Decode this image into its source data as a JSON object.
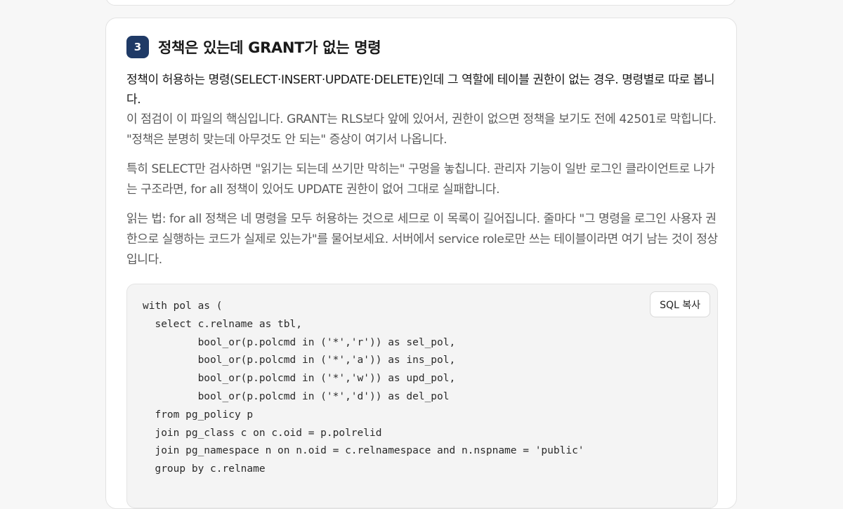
{
  "section": {
    "step_number": "3",
    "title": "정책은 있는데 GRANT가 없는 명령",
    "lead": "정책이 허용하는 명령(SELECT·INSERT·UPDATE·DELETE)인데 그 역할에 테이블 권한이 없는 경우. 명령별로 따로 봅니다.",
    "paragraphs": [
      "이 점검이 이 파일의 핵심입니다. GRANT는 RLS보다 앞에 있어서, 권한이 없으면 정책을 보기도 전에 42501로 막힙니다. \"정책은 분명히 맞는데 아무것도 안 되는\" 증상이 여기서 나옵니다.",
      "특히 SELECT만 검사하면 \"읽기는 되는데 쓰기만 막히는\" 구멍을 놓칩니다. 관리자 기능이 일반 로그인 클라이언트로 나가는 구조라면, for all 정책이 있어도 UPDATE 권한이 없어 그대로 실패합니다.",
      "읽는 법: for all 정책은 네 명령을 모두 허용하는 것으로 세므로 이 목록이 길어집니다. 줄마다 \"그 명령을 로그인 사용자 권한으로 실행하는 코드가 실제로 있는가\"를 물어보세요. 서버에서 service role로만 쓰는 테이블이라면 여기 남는 것이 정상입니다."
    ]
  },
  "code": {
    "copy_label": "SQL 복사",
    "lines": [
      "with pol as (",
      "  select c.relname as tbl,",
      "         bool_or(p.polcmd in ('*','r')) as sel_pol,",
      "         bool_or(p.polcmd in ('*','a')) as ins_pol,",
      "         bool_or(p.polcmd in ('*','w')) as upd_pol,",
      "         bool_or(p.polcmd in ('*','d')) as del_pol",
      "  from pg_policy p",
      "  join pg_class c on c.oid = p.polrelid",
      "  join pg_namespace n on n.oid = c.relnamespace and n.nspname = 'public'",
      "  group by c.relname"
    ]
  },
  "colors": {
    "badge": "#1f3a66",
    "page_background": "#f7f7f7",
    "code_background": "#f4f4f4"
  }
}
